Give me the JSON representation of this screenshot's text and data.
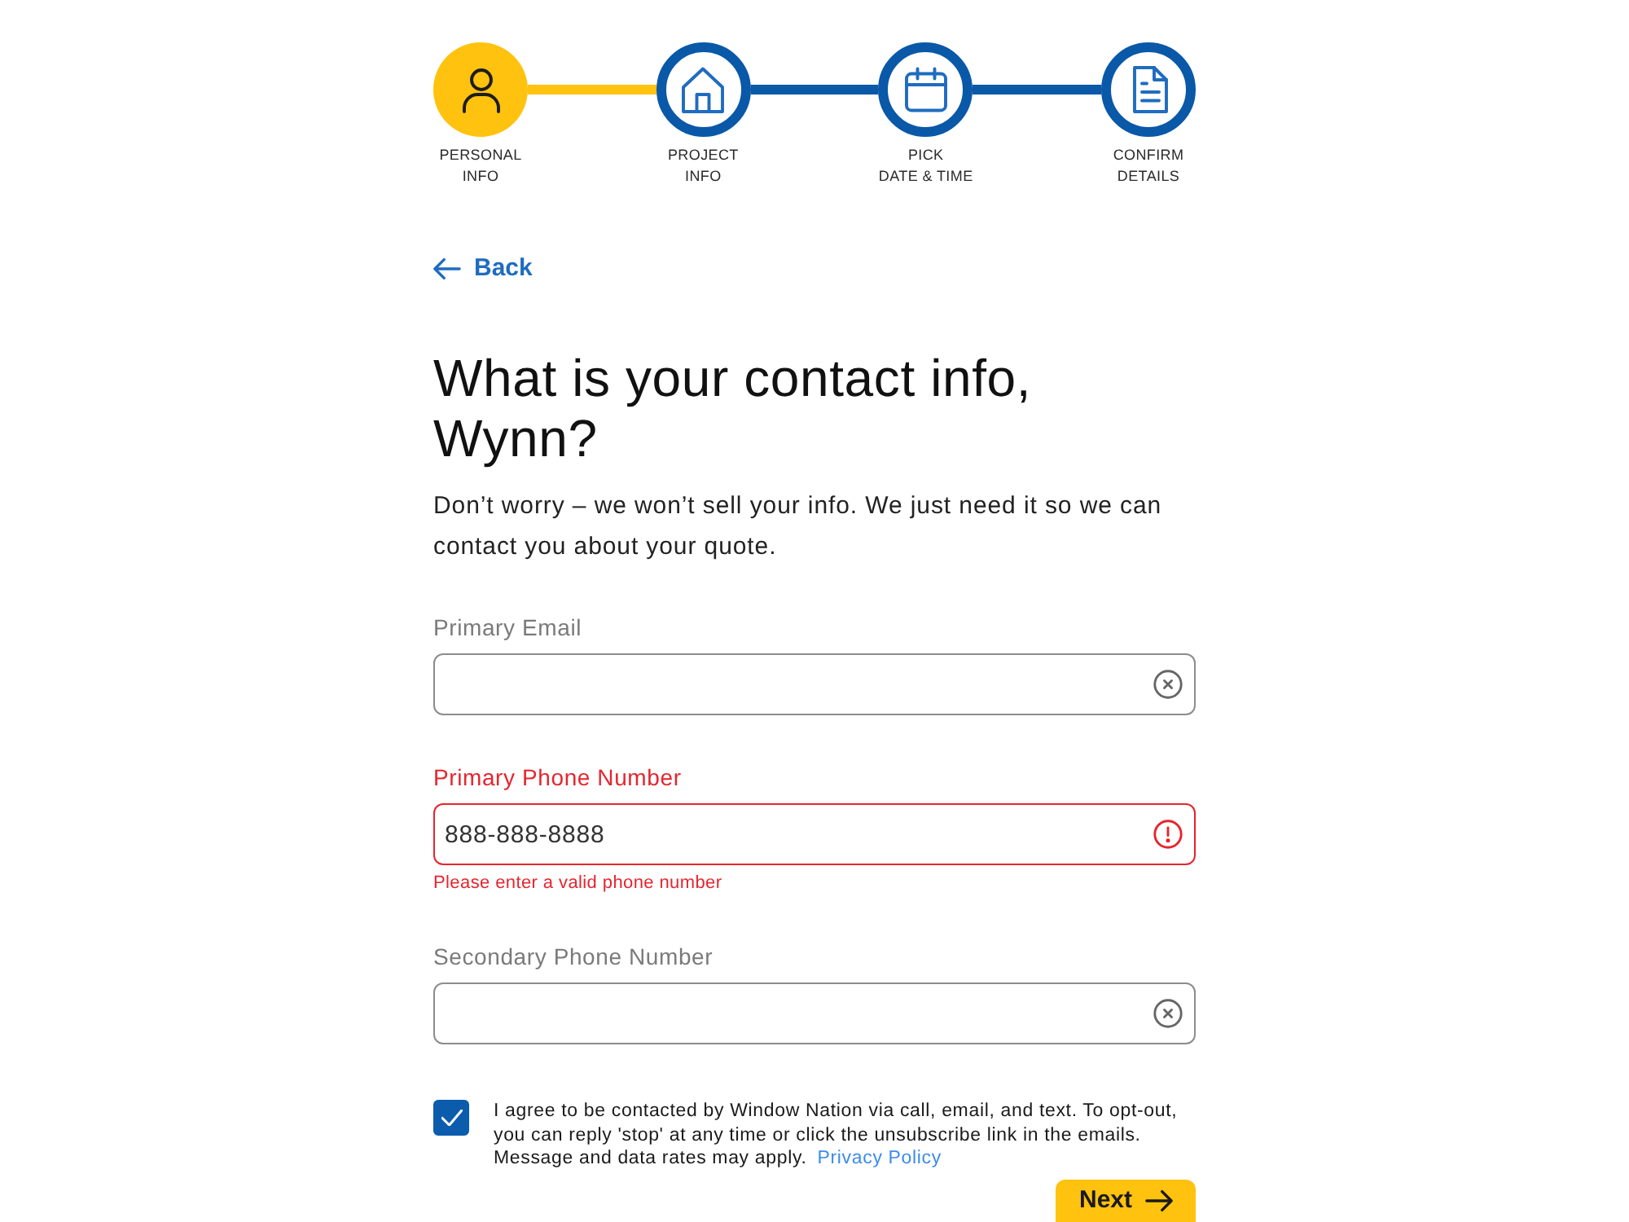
{
  "steps": [
    {
      "label": "PERSONAL\nINFO",
      "selected": true
    },
    {
      "label": "PROJECT\nINFO",
      "selected": false
    },
    {
      "label": "PICK\nDATE & TIME",
      "selected": false
    },
    {
      "label": "CONFIRM\nDETAILS",
      "selected": false
    }
  ],
  "back_link": "Back",
  "heading": "What is your contact info, Wynn?",
  "intro": "Don’t worry – we won’t sell your info. We just need it so we can contact you about your quote.",
  "fields": [
    {
      "label": "Primary Email",
      "invalid": false
    },
    {
      "label": "Primary Phone Number",
      "value": "888-888-8888",
      "invalid": true,
      "error": "Please enter a valid phone number"
    },
    {
      "label": "Secondary Phone Number",
      "invalid": false
    }
  ],
  "consent": {
    "checked": true,
    "text": "I agree to be contacted by Window Nation via call, email, and text. To opt-out, you can reply 'stop' at any time or click the unsubscribe link in the emails. Message and data rates may apply.",
    "link": "Privacy Policy"
  },
  "next_button": "Next"
}
